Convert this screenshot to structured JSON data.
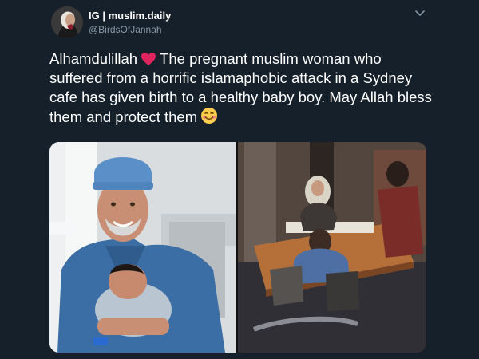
{
  "user": {
    "display_name": "IG | muslim.daily",
    "handle": "@BirdsOfJannah"
  },
  "tweet": {
    "part1": "Alhamdulillah",
    "part2": "The pregnant muslim woman who suffered from a horrific islamaphobic attack in a Sydney cafe has given birth to a healthy baby boy. May Allah bless them and protect them",
    "emojis": [
      "red-heart-emoji",
      "smiling-face-emoji"
    ]
  },
  "media": {
    "photos": [
      "doctor-holding-newborn-photo",
      "cafe-attack-cctv-photo"
    ]
  },
  "colors": {
    "background": "#15202b",
    "text": "#ffffff",
    "secondary_text": "#8899a6",
    "heart": "#e0245e"
  }
}
